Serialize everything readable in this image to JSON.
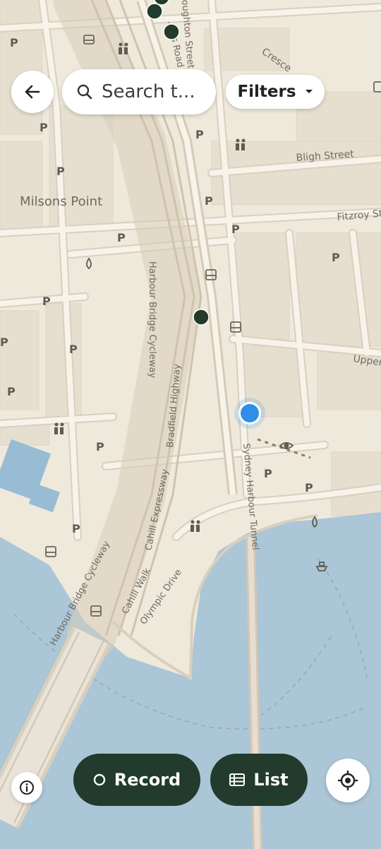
{
  "map": {
    "places": {
      "milsons_point": "Milsons Point"
    },
    "streets": {
      "bligh_street": "Bligh Street",
      "fitzroy_street": "Fitzroy St",
      "upper": "Upper",
      "crescent": "Cresce",
      "broughton_street": "oughton Street",
      "road_top": "...n's Road",
      "harbour_bridge_cycleway_upper": "Harbour Bridge Cycleway",
      "bradfield_highway": "Bradfield Highway",
      "cahill_expressway": "Cahill Expressway",
      "cahill_walk": "Cahill Walk",
      "olympic_drive": "Olympic Drive",
      "harbour_bridge_cycleway_lower": "Harbour Bridge Cycleway",
      "sydney_harbour_tunnel": "Sydney Harbour Tunnel"
    },
    "parking_label": "P",
    "colors": {
      "land": "#efe9dc",
      "block": "#e6dfd0",
      "water": "#abc6d6",
      "road": "#f7f3ea",
      "road_outline": "#d9cfbd",
      "user_location": "#2f8fe6",
      "observation_marker": "#223b2c",
      "button_dark": "#223b2c"
    }
  },
  "search": {
    "text": "Search t..."
  },
  "filters": {
    "label": "Filters"
  },
  "actions": {
    "record_label": "Record",
    "list_label": "List"
  },
  "icons": {
    "back": "arrow-left-icon",
    "search": "search-icon",
    "dropdown": "caret-down-icon",
    "info": "info-icon",
    "record": "circle-outline-icon",
    "list": "list-icon",
    "locate": "locate-crosshair-icon"
  }
}
